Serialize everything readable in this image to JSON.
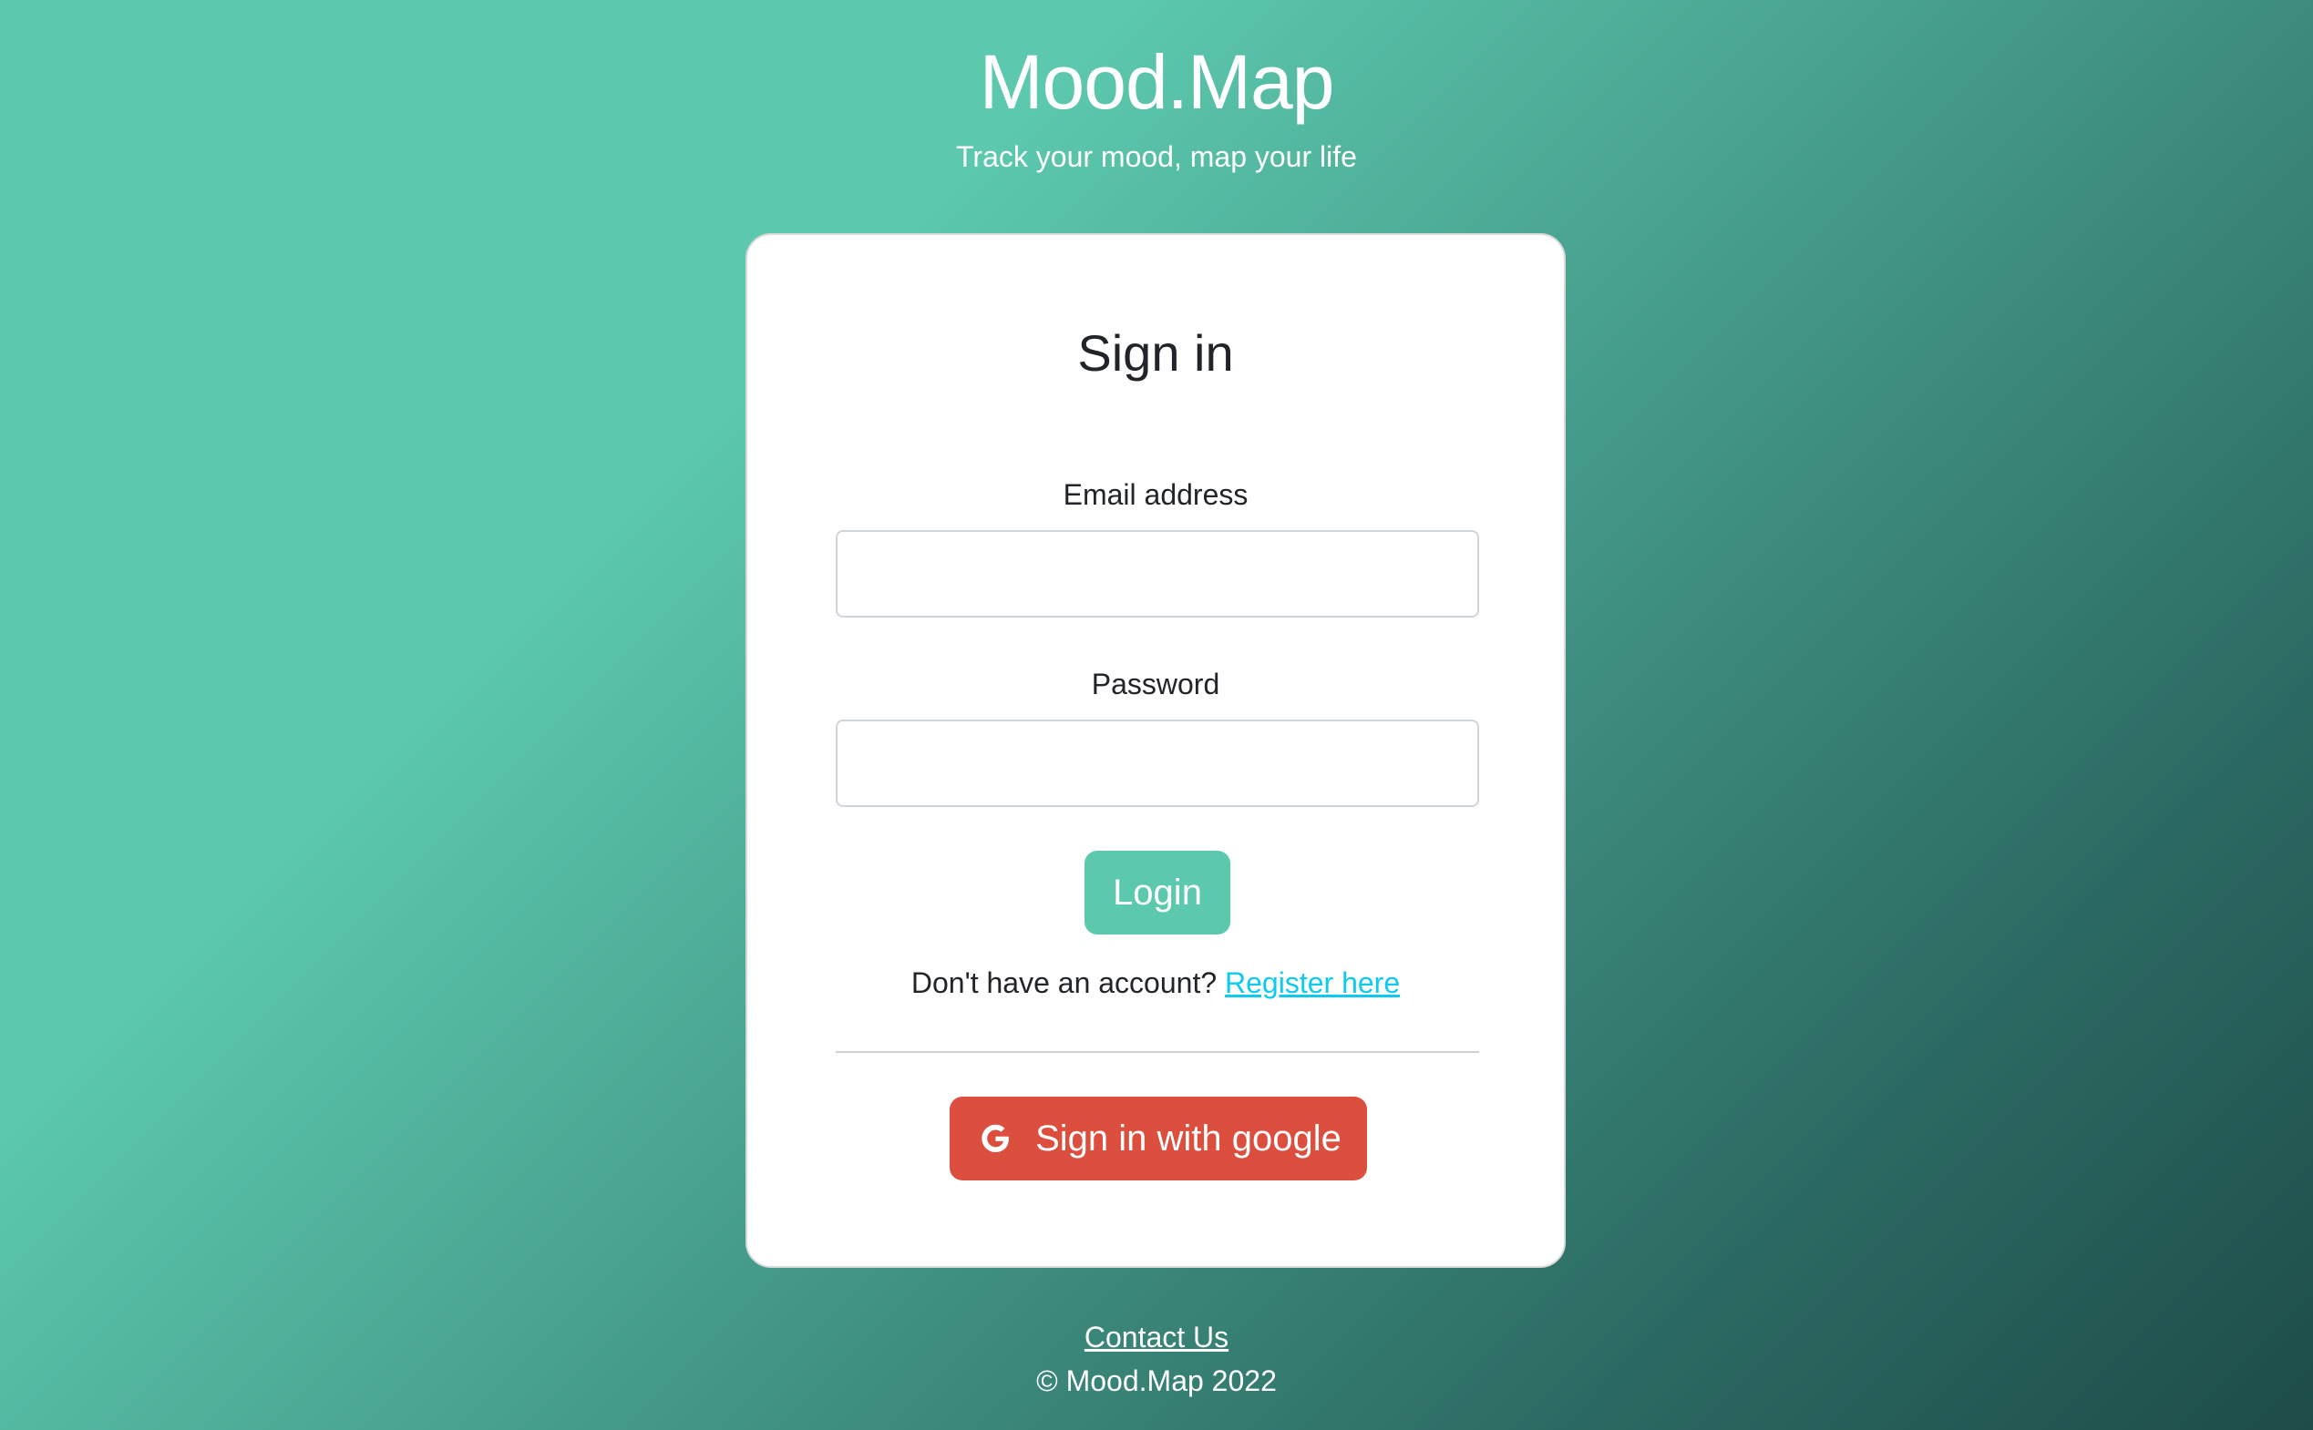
{
  "header": {
    "title": "Mood.Map",
    "tagline": "Track your mood, map your life"
  },
  "signin": {
    "title": "Sign in",
    "email_label": "Email address",
    "email_value": "",
    "password_label": "Password",
    "password_value": "",
    "login_label": "Login",
    "no_account_text": "Don't have an account?",
    "register_link": "Register here",
    "google_label": "Sign in with google",
    "google_icon": "google-g-icon"
  },
  "footer": {
    "contact_link": "Contact Us",
    "copyright": "© Mood.Map 2022"
  },
  "colors": {
    "accent": "#5cc9ae",
    "google": "#dc4e3d",
    "link": "#0dcaf0",
    "gradient_dark": "#1e4c49"
  }
}
